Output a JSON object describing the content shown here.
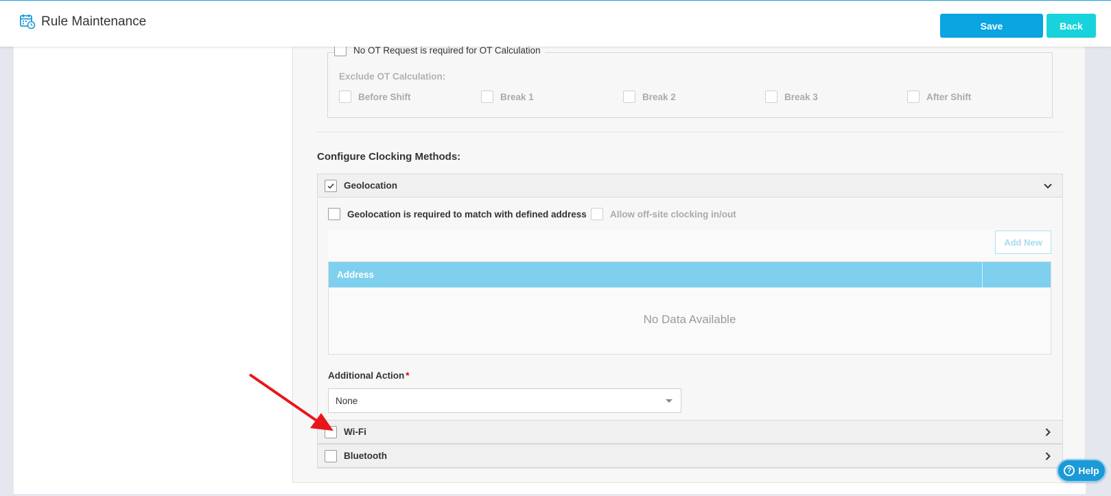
{
  "header": {
    "title": "Rule Maintenance",
    "save_label": "Save",
    "back_label": "Back"
  },
  "ot": {
    "no_ot_label": "No OT Request is required for OT Calculation",
    "exclude_title": "Exclude OT Calculation:",
    "exclude_items": [
      "Before Shift",
      "Break 1",
      "Break 2",
      "Break 3",
      "After Shift"
    ]
  },
  "clocking": {
    "title": "Configure Clocking Methods:",
    "geolocation": {
      "label": "Geolocation",
      "checked": true,
      "expanded": true,
      "match_label": "Geolocation is required to match with defined address",
      "offsite_label": "Allow off-site clocking in/out",
      "add_new_label": "Add New",
      "table": {
        "columns": [
          "Address",
          ""
        ],
        "empty_text": "No Data Available"
      },
      "additional_action": {
        "label": "Additional Action",
        "required_mark": "*",
        "value": "None"
      }
    },
    "wifi": {
      "label": "Wi-Fi",
      "checked": false
    },
    "bluetooth": {
      "label": "Bluetooth",
      "checked": false
    }
  },
  "help": {
    "label": "Help"
  },
  "colors": {
    "accent": "#0aa4e0",
    "back": "#18d3dc",
    "table_header": "#7ed0ee",
    "annotation_arrow": "#e8161b"
  }
}
